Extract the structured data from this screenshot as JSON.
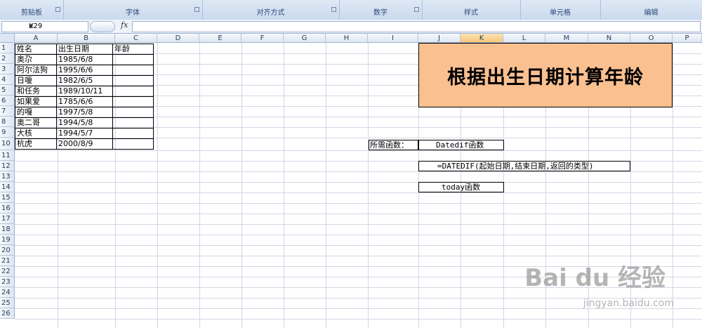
{
  "ribbon": {
    "groups": [
      "剪贴板",
      "字体",
      "对齐方式",
      "数字",
      "样式",
      "单元格",
      "编辑"
    ]
  },
  "formula_bar": {
    "name_box": "K29",
    "fx_symbol": "fx",
    "formula": ""
  },
  "columns": [
    "A",
    "B",
    "C",
    "D",
    "E",
    "F",
    "G",
    "H",
    "I",
    "J",
    "K",
    "L",
    "M",
    "N",
    "O",
    "P"
  ],
  "selected_column": "K",
  "rows": [
    "1",
    "2",
    "3",
    "4",
    "5",
    "6",
    "7",
    "8",
    "9",
    "10",
    "11",
    "12",
    "13",
    "14",
    "15",
    "16",
    "17",
    "18",
    "19",
    "20",
    "21",
    "22",
    "23",
    "24",
    "25",
    "26"
  ],
  "table": {
    "headers": [
      "姓名",
      "出生日期",
      "年龄"
    ],
    "rows": [
      [
        "奥尕",
        "1985/6/8",
        ""
      ],
      [
        "阿尔法狗",
        "1995/6/6",
        ""
      ],
      [
        "日嗄",
        "1982/6/5",
        ""
      ],
      [
        "和任务",
        "1989/10/11",
        ""
      ],
      [
        "如果爱",
        "1785/6/6",
        ""
      ],
      [
        "的嘎",
        "1997/5/8",
        ""
      ],
      [
        "奥二哥",
        "1994/5/8",
        ""
      ],
      [
        "大核",
        "1994/5/7",
        ""
      ],
      [
        "杭虎",
        "2000/8/9",
        ""
      ]
    ]
  },
  "title_box": "根据出生日期计算年龄",
  "notes": {
    "label": "所需函数：",
    "func1": "Datedif函数",
    "syntax": "=DATEDIF(起始日期,结束日期,返回的类型)",
    "func2": "today函数"
  },
  "watermark": {
    "brand": "Bai du 经验",
    "url": "jingyan.baidu.com"
  },
  "colors": {
    "title_fill": "#fac090",
    "header_selected": "#f6c77a",
    "grid": "#d0d7e5"
  }
}
